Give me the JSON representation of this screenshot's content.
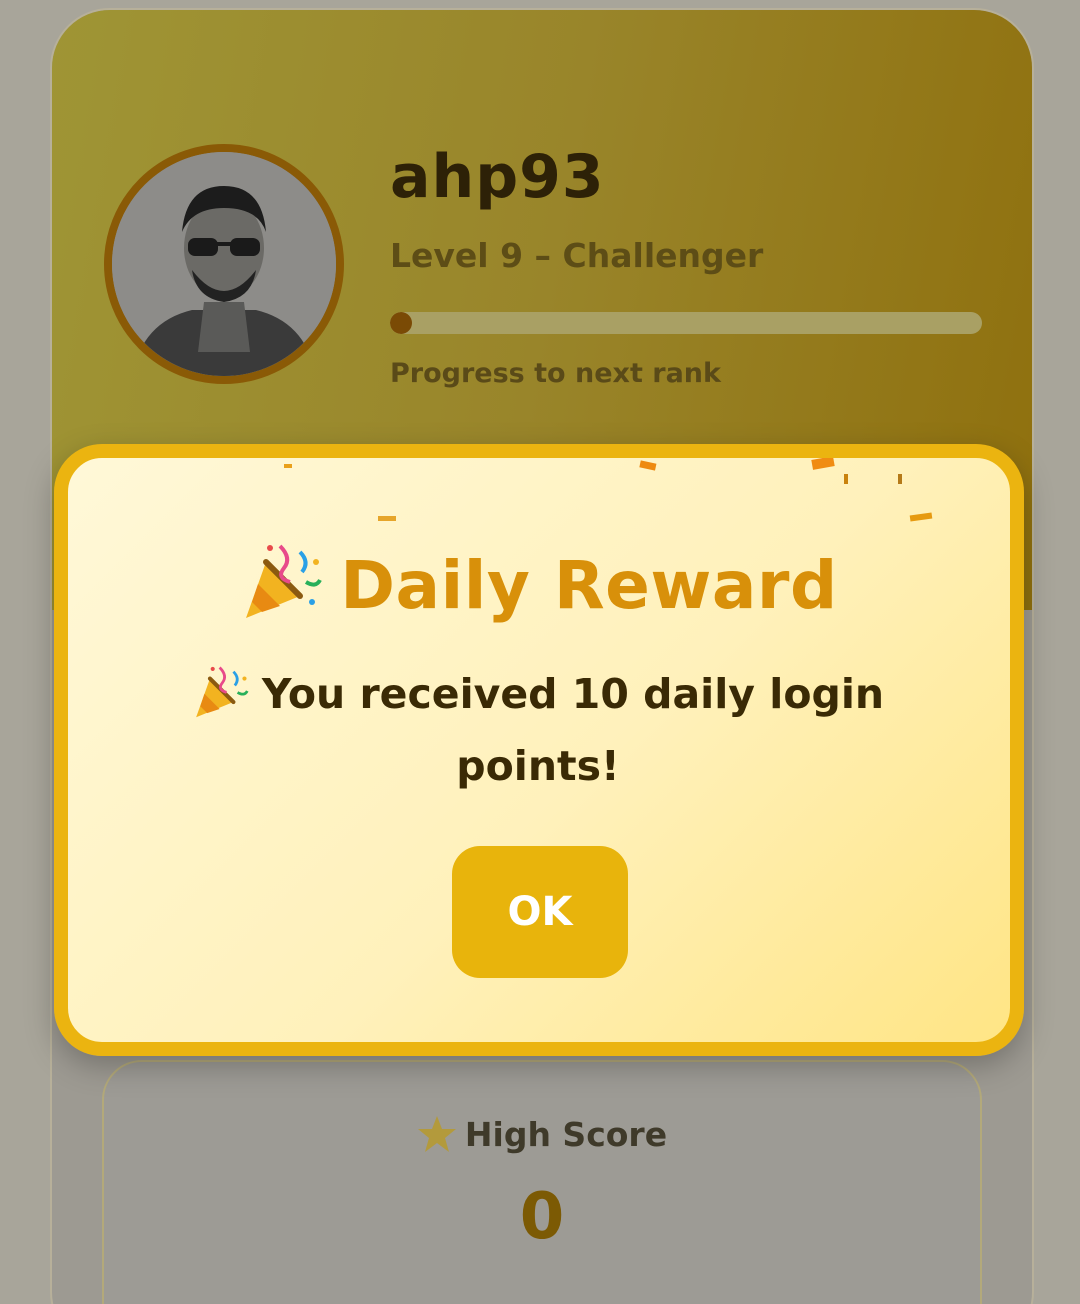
{
  "profile": {
    "username": "ahp93",
    "level_text": "Level 9 – Challenger",
    "progress_label": "Progress to next rank",
    "progress_fraction": 0.02
  },
  "stats": {
    "high_score_label": "High Score",
    "high_score_value": "0",
    "icon": "star-icon"
  },
  "modal": {
    "title": "Daily Reward",
    "title_icon": "party-popper-icon",
    "message": "You received 10 daily login points!",
    "message_icon": "party-popper-icon",
    "ok_label": "OK"
  },
  "colors": {
    "accent": "#ebb410",
    "title": "#d8900a",
    "modal_bg": "#fff4c8"
  }
}
